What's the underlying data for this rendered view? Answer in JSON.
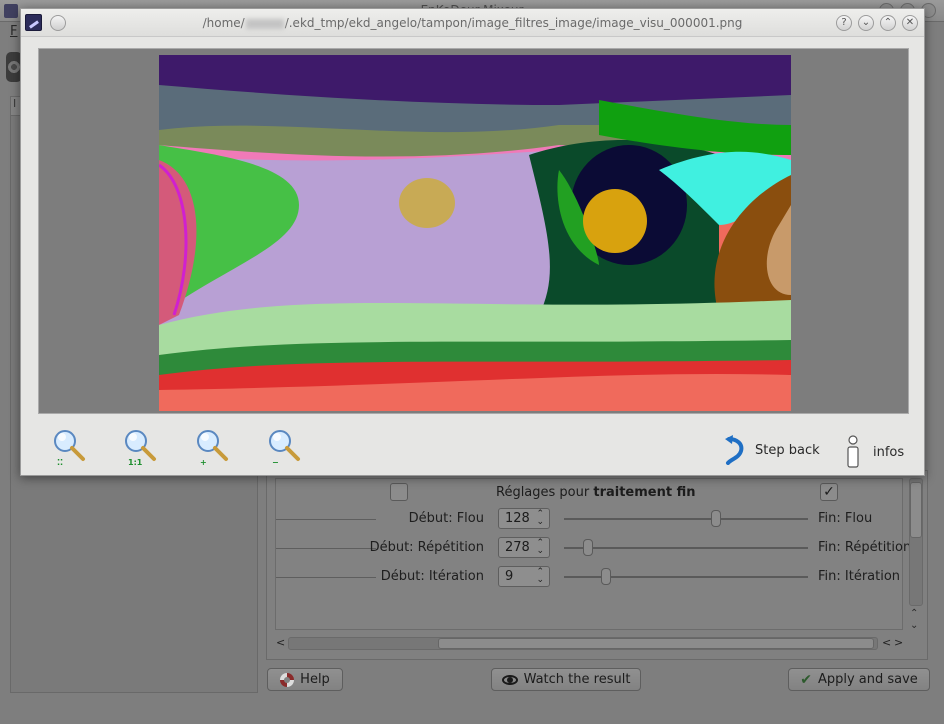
{
  "background_window": {
    "title": "EnKoDeur-Mixeur",
    "menu_first": "F",
    "left_tab_label": "I",
    "fine_settings": {
      "label_prefix": "Réglages pour ",
      "label_bold": "traitement fin",
      "left_checked": false,
      "right_checked": true,
      "right_check_glyph": "✓"
    },
    "rows": [
      {
        "start_label": "Début: Flou",
        "value": "128",
        "end_label": "Fin: Flou",
        "slider_fraction": 0.63
      },
      {
        "start_label": "Début: Répétition",
        "value": "278",
        "end_label": "Fin: Répétition",
        "slider_fraction": 0.08
      },
      {
        "start_label": "Début: Itération",
        "value": "9",
        "end_label": "Fin: Itération",
        "slider_fraction": 0.16
      }
    ],
    "spin_arrows": "⌃⌄",
    "buttons": {
      "help": "Help",
      "watch": "Watch the result",
      "apply": "Apply and save"
    }
  },
  "dialog": {
    "title_prefix": "/home/",
    "title_suffix": "/.ekd_tmp/ekd_angelo/tampon/image_filtres_image/image_visu_000001.png",
    "controls": [
      "?",
      "⌄",
      "⌃",
      "✕"
    ],
    "toolbar": {
      "zoom_buttons": [
        {
          "name": "zoom-fit-icon",
          "badge": "⁚⁚"
        },
        {
          "name": "zoom-original-icon",
          "badge": "1:1"
        },
        {
          "name": "zoom-in-icon",
          "badge": "+"
        },
        {
          "name": "zoom-out-icon",
          "badge": "−"
        }
      ],
      "step_back": "Step back",
      "infos": "infos"
    }
  },
  "colors": {
    "accent_blue": "#1f6fc4",
    "badge_green": "#1e8f2e",
    "dialog_bg": "#e6e6e4",
    "viewer_bg": "#7d7d7d"
  }
}
